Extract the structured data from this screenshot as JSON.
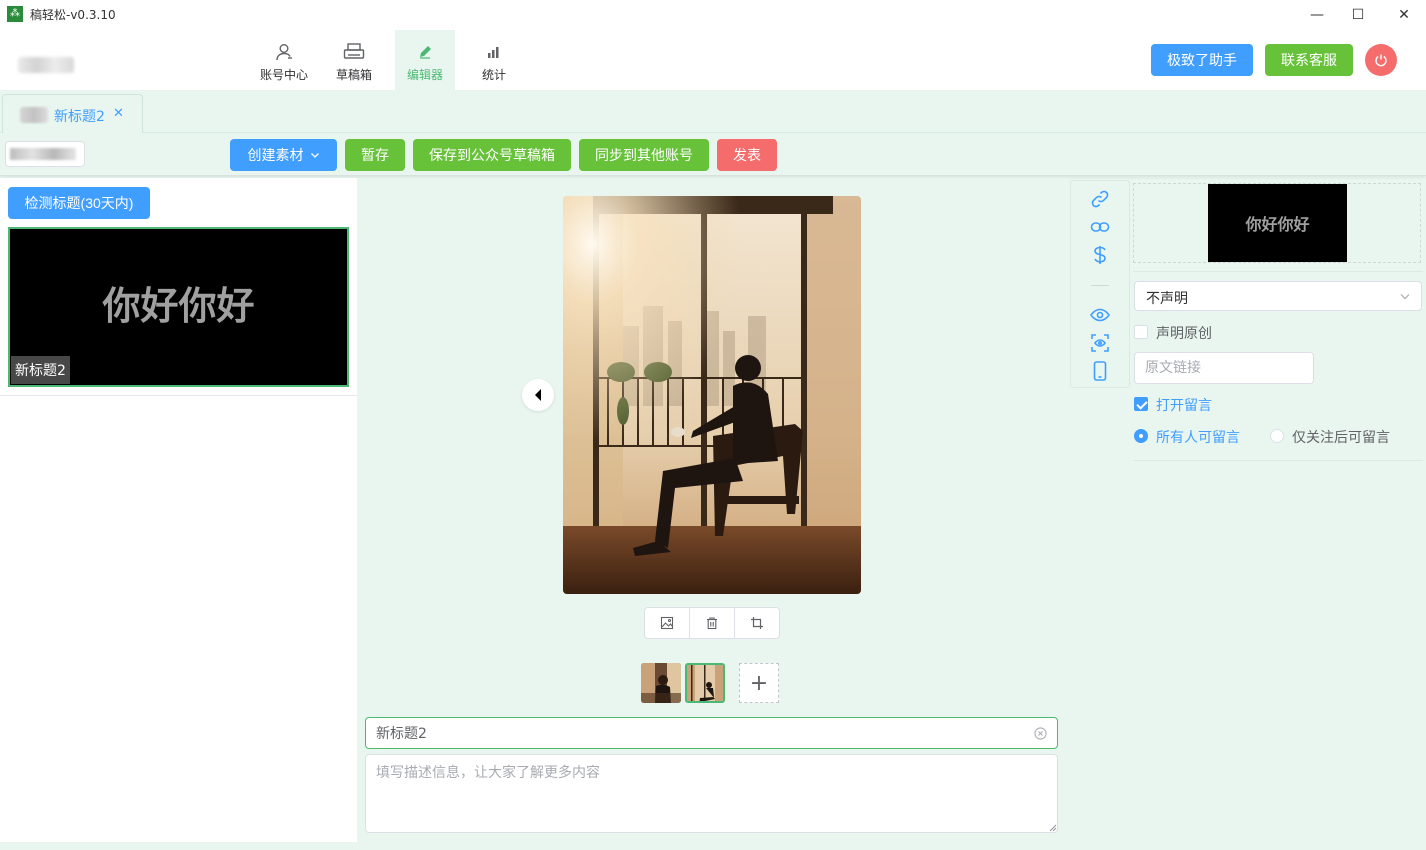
{
  "app": {
    "title": "稿轻松-v0.3.10",
    "logo_glyph": "⁂"
  },
  "window_controls": {
    "minimize": "—",
    "maximize": "☐",
    "close": "✕"
  },
  "nav": [
    {
      "label": "账号中心",
      "icon": "user-icon"
    },
    {
      "label": "草稿箱",
      "icon": "printer-icon"
    },
    {
      "label": "编辑器",
      "icon": "pencil-icon"
    },
    {
      "label": "统计",
      "icon": "bar-chart-icon"
    }
  ],
  "header_buttons": {
    "assistant": "极致了助手",
    "support": "联系客服"
  },
  "tab": {
    "label": "新标题2",
    "close": "✕"
  },
  "toolbar": {
    "create_material": "创建素材",
    "save_temp": "暂存",
    "save_draft": "保存到公众号草稿箱",
    "sync": "同步到其他账号",
    "publish": "发表"
  },
  "left": {
    "detect_btn": "检测标题(30天内)",
    "card_text": "你好你好",
    "card_label": "新标题2"
  },
  "editor": {
    "title_value": "新标题2",
    "desc_placeholder": "填写描述信息，让大家了解更多内容",
    "add_glyph": "+"
  },
  "right": {
    "cover_text": "你好你好",
    "declare_value": "不声明",
    "original_label": "声明原创",
    "link_placeholder": "原文链接",
    "open_comment_label": "打开留言",
    "radio_all": "所有人可留言",
    "radio_follow": "仅关注后可留言"
  },
  "colors": {
    "primary": "#409eff",
    "success": "#67c23a",
    "danger": "#f56c6c",
    "accent_green": "#4cb873",
    "background": "#e8f6ef"
  }
}
